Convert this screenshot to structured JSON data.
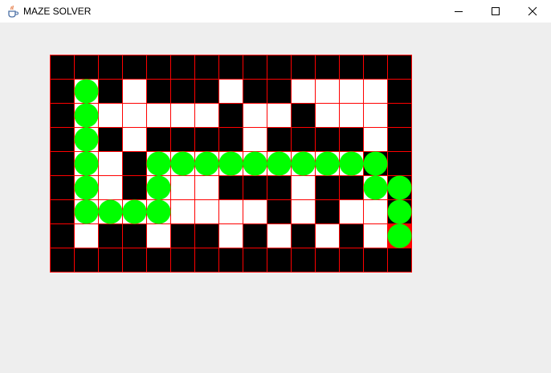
{
  "window": {
    "title": "MAZE SOLVER",
    "icon": "java-cup-icon",
    "controls": [
      "minimize-icon",
      "maximize-icon",
      "close-icon"
    ]
  },
  "maze": {
    "rows": 9,
    "cols": 15,
    "grid": [
      "###############",
      "#.#.###.##....#",
      "#......#..#...#",
      "#.#.####.####.#",
      "#..#.........##",
      "#..#...###.##.#",
      "#........#.#..#",
      "#.##.##.#.#.#.#",
      "###############"
    ],
    "path": [
      [
        1,
        1
      ],
      [
        2,
        1
      ],
      [
        3,
        1
      ],
      [
        4,
        1
      ],
      [
        5,
        1
      ],
      [
        6,
        1
      ],
      [
        6,
        2
      ],
      [
        6,
        3
      ],
      [
        6,
        4
      ],
      [
        5,
        4
      ],
      [
        4,
        4
      ],
      [
        4,
        5
      ],
      [
        4,
        6
      ],
      [
        4,
        7
      ],
      [
        4,
        8
      ],
      [
        4,
        9
      ],
      [
        4,
        10
      ],
      [
        4,
        11
      ],
      [
        4,
        12
      ],
      [
        4,
        13
      ],
      [
        5,
        13
      ],
      [
        5,
        14
      ],
      [
        6,
        14
      ],
      [
        7,
        14
      ]
    ],
    "end": [
      7,
      14
    ],
    "colors": {
      "wall": "#000000",
      "open": "#ffffff",
      "grid_line": "#ff0000",
      "path": "#00ff00",
      "end_cell": "#ff0000"
    }
  }
}
